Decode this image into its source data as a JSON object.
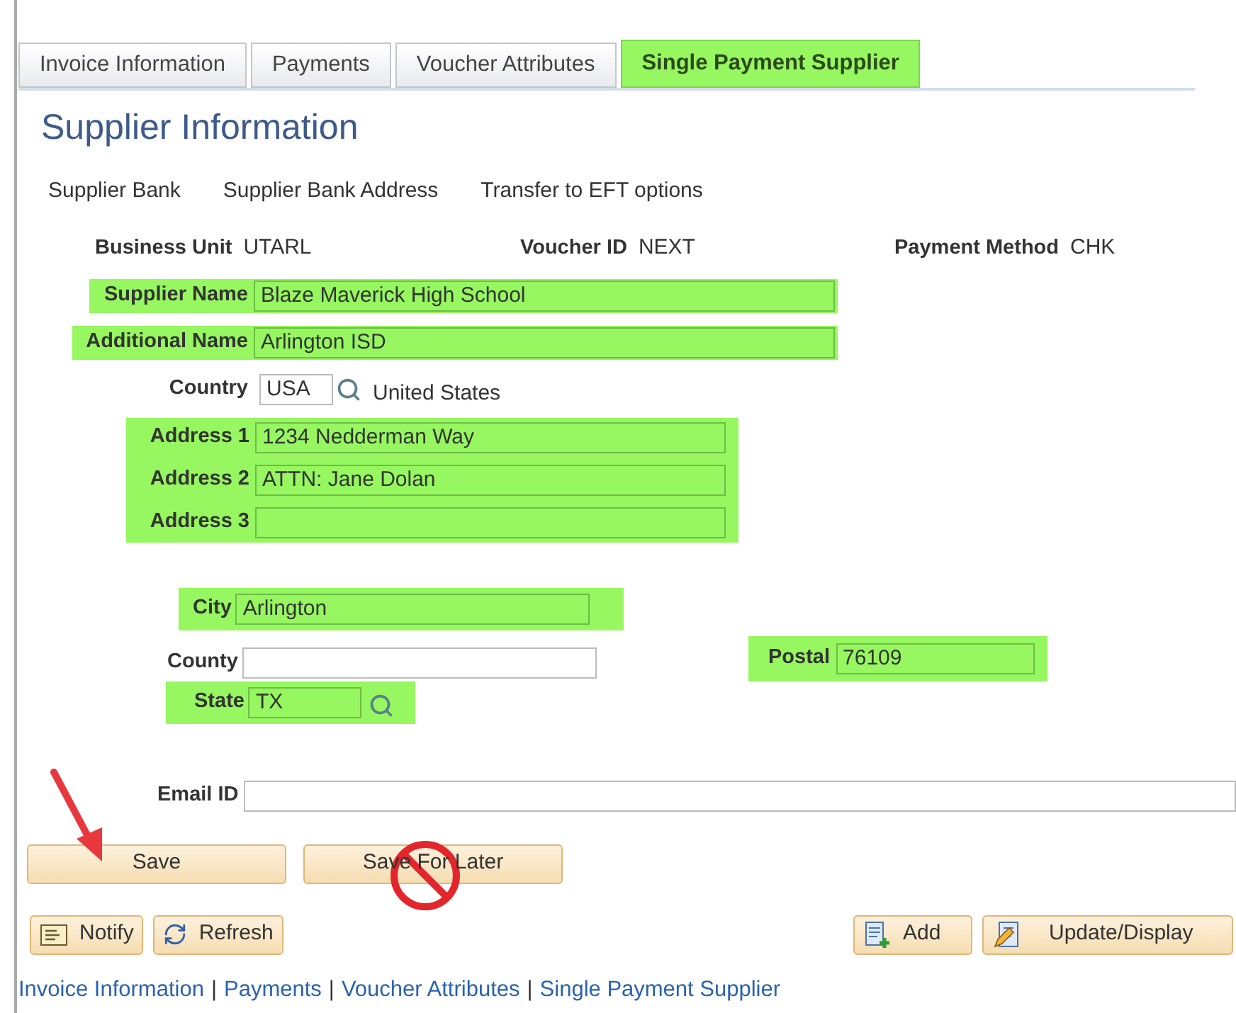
{
  "tabs": [
    {
      "label": "Invoice Information",
      "selected": false
    },
    {
      "label": "Payments",
      "selected": false
    },
    {
      "label": "Voucher Attributes",
      "selected": false
    },
    {
      "label": "Single Payment Supplier",
      "selected": true,
      "highlighted": true
    }
  ],
  "title": "Supplier Information",
  "links": [
    "Supplier Bank",
    "Supplier Bank Address",
    "Transfer to EFT options"
  ],
  "info": [
    {
      "label": "Business Unit",
      "value": "UTARL"
    },
    {
      "label": "Voucher ID",
      "value": "NEXT"
    },
    {
      "label": "Payment Method",
      "value": "CHK"
    }
  ],
  "fields": [
    {
      "kind": "text",
      "label": "Supplier Name",
      "value": "Blaze Maverick High School",
      "highlighted": true
    },
    {
      "kind": "text",
      "label": "Additional Name",
      "value": "Arlington ISD",
      "highlighted": true
    },
    {
      "kind": "lookup",
      "label": "Country",
      "value": "USA",
      "description": "United States",
      "highlighted": false
    },
    {
      "kind": "group",
      "highlighted": true,
      "fields": [
        {
          "label": "Address 1",
          "value": "1234 Nedderman Way"
        },
        {
          "label": "Address 2",
          "value": "ATTN: Jane Dolan"
        },
        {
          "label": "Address 3"
        }
      ]
    }
  ],
  "location": {
    "city": {
      "label": "City",
      "value": "Arlington",
      "highlighted": true
    },
    "county": {
      "label": "County",
      "highlighted": false
    },
    "state": {
      "label": "State",
      "value": "TX",
      "highlighted": true
    },
    "postal": {
      "label": "Postal",
      "value": "76109",
      "highlighted": true
    }
  },
  "email": {
    "label": "Email ID"
  },
  "actions": [
    "Save",
    "Save For Later"
  ],
  "toolbar_left": [
    {
      "kind": "notify",
      "label": "Notify"
    },
    {
      "kind": "refresh",
      "label": "Refresh"
    }
  ],
  "toolbar_right": [
    {
      "kind": "add",
      "label": "Add"
    },
    {
      "kind": "update",
      "label": "Update/Display"
    }
  ],
  "bottom_links": {
    "separator": "|",
    "items": [
      "Invoice Information",
      "Payments",
      "Voucher Attributes",
      "Single Payment Supplier"
    ]
  }
}
